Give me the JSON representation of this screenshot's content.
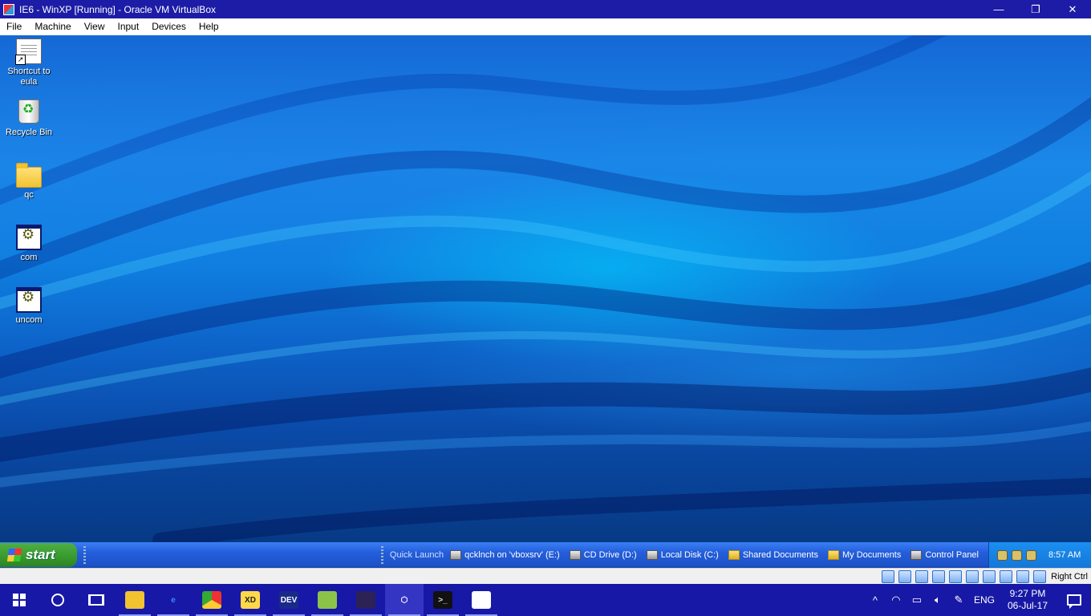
{
  "window": {
    "title": "IE6 - WinXP [Running] - Oracle VM VirtualBox",
    "controls": {
      "minimize": "—",
      "maximize": "❐",
      "close": "✕"
    }
  },
  "menu": [
    "File",
    "Machine",
    "View",
    "Input",
    "Devices",
    "Help"
  ],
  "desktop": {
    "icons": [
      {
        "label": "Shortcut to eula",
        "icon": "document-shortcut-icon"
      },
      {
        "label": "Recycle Bin",
        "icon": "recycle-bin-icon"
      },
      {
        "label": "qc",
        "icon": "folder-icon"
      },
      {
        "label": "com",
        "icon": "executable-icon"
      },
      {
        "label": "uncom",
        "icon": "executable-icon"
      }
    ]
  },
  "xp_taskbar": {
    "start_label": "start",
    "quick_launch_label": "Quick Launch",
    "items": [
      {
        "label": "qcklnch on 'vboxsrv' (E:)",
        "icon": "network-drive-icon"
      },
      {
        "label": "CD Drive (D:)",
        "icon": "cd-drive-icon"
      },
      {
        "label": "Local Disk (C:)",
        "icon": "local-disk-icon"
      },
      {
        "label": "Shared Documents",
        "icon": "folder-icon"
      },
      {
        "label": "My Documents",
        "icon": "folder-icon"
      },
      {
        "label": "Control Panel",
        "icon": "control-panel-icon"
      }
    ],
    "clock": "8:57 AM"
  },
  "vbox_status": {
    "host_key": "Right Ctrl"
  },
  "win10_taskbar": {
    "apps": [
      {
        "name": "file-explorer",
        "glyph": "",
        "bg": "#f2c230",
        "fg": "#1c4da6"
      },
      {
        "name": "edge",
        "glyph": "e",
        "bg": "transparent",
        "fg": "#3b8df0"
      },
      {
        "name": "chrome",
        "glyph": "",
        "bg": "conic-gradient(#e33 0 33%,#fc3 33% 66%,#3a3 66% 100%)",
        "fg": "#fff"
      },
      {
        "name": "xd",
        "glyph": "XD",
        "bg": "#ffd84a",
        "fg": "#222"
      },
      {
        "name": "devcpp",
        "glyph": "DEV",
        "bg": "#1a2a8a",
        "fg": "#fff"
      },
      {
        "name": "android-studio",
        "glyph": "",
        "bg": "#8bc34a",
        "fg": "#1a3a1a"
      },
      {
        "name": "eclipse",
        "glyph": "",
        "bg": "#2c2255",
        "fg": "#fff"
      },
      {
        "name": "virtualbox",
        "glyph": "⬡",
        "bg": "transparent",
        "fg": "#ffffff"
      },
      {
        "name": "terminal",
        "glyph": ">_",
        "bg": "#111",
        "fg": "#ddd"
      },
      {
        "name": "visual-studio",
        "glyph": "",
        "bg": "#ffffff",
        "fg": "#7a3fc8"
      }
    ],
    "active_app": "virtualbox",
    "language": "ENG",
    "time": "9:27 PM",
    "date": "06-Jul-17"
  }
}
